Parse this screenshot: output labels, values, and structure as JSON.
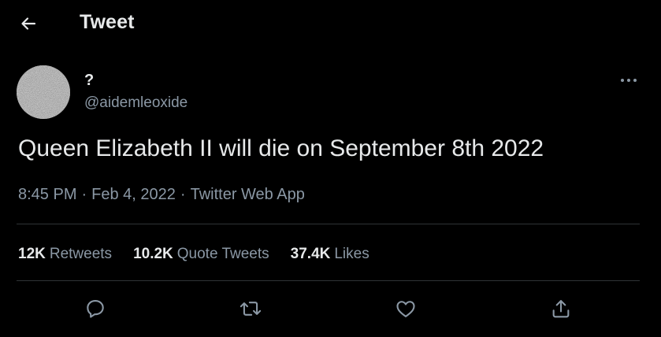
{
  "header": {
    "title": "Tweet",
    "back_icon": "arrow-left-icon"
  },
  "author": {
    "display_name": "?",
    "handle": "@aidemleoxide",
    "avatar": "noise-avatar"
  },
  "tweet": {
    "text": "Queen Elizabeth II will die on September 8th 2022",
    "time": "8:45 PM",
    "separator": "·",
    "date": "Feb 4, 2022",
    "source": "Twitter Web App"
  },
  "stats": [
    {
      "value": "12K",
      "label": "Retweets"
    },
    {
      "value": "10.2K",
      "label": "Quote Tweets"
    },
    {
      "value": "37.4K",
      "label": "Likes"
    }
  ],
  "actions": [
    "reply-icon",
    "retweet-icon",
    "like-icon",
    "share-icon"
  ],
  "colors": {
    "background": "#000000",
    "primary_text": "#e7e9ea",
    "secondary_text": "#8b98a5",
    "divider": "#2f3336"
  }
}
